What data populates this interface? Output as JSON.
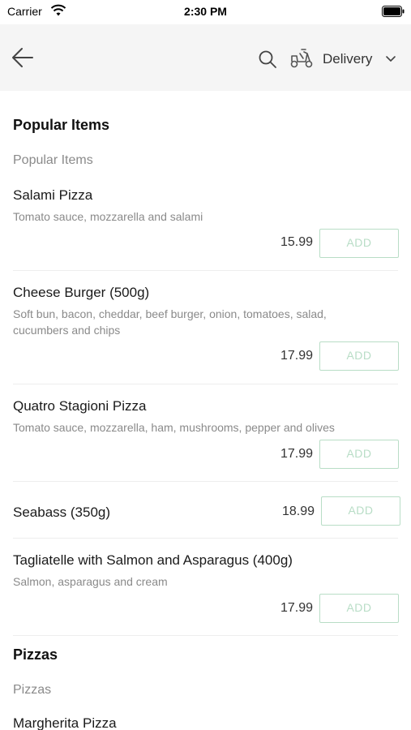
{
  "status": {
    "carrier": "Carrier",
    "time": "2:30 PM"
  },
  "nav": {
    "delivery_label": "Delivery"
  },
  "sections": [
    {
      "title": "Popular Items",
      "subtitle": "Popular Items",
      "items": [
        {
          "name": "Salami Pizza",
          "desc": "Tomato sauce, mozzarella and salami",
          "price": "15.99",
          "add": "ADD"
        },
        {
          "name": "Cheese Burger (500g)",
          "desc": "Soft bun, bacon, cheddar, beef burger, onion, tomatoes, salad, cucumbers and chips",
          "price": "17.99",
          "add": "ADD"
        },
        {
          "name": "Quatro Stagioni Pizza",
          "desc": "Tomato sauce, mozzarella, ham, mushrooms, pepper and olives",
          "price": "17.99",
          "add": "ADD"
        },
        {
          "name": "Seabass (350g)",
          "desc": "",
          "price": "18.99",
          "add": "ADD"
        },
        {
          "name": "Tagliatelle with Salmon and Asparagus (400g)",
          "desc": "Salmon, asparagus and cream",
          "price": "17.99",
          "add": "ADD"
        }
      ]
    },
    {
      "title": "Pizzas",
      "subtitle": "Pizzas",
      "items": [
        {
          "name": "Margherita Pizza"
        }
      ]
    }
  ]
}
